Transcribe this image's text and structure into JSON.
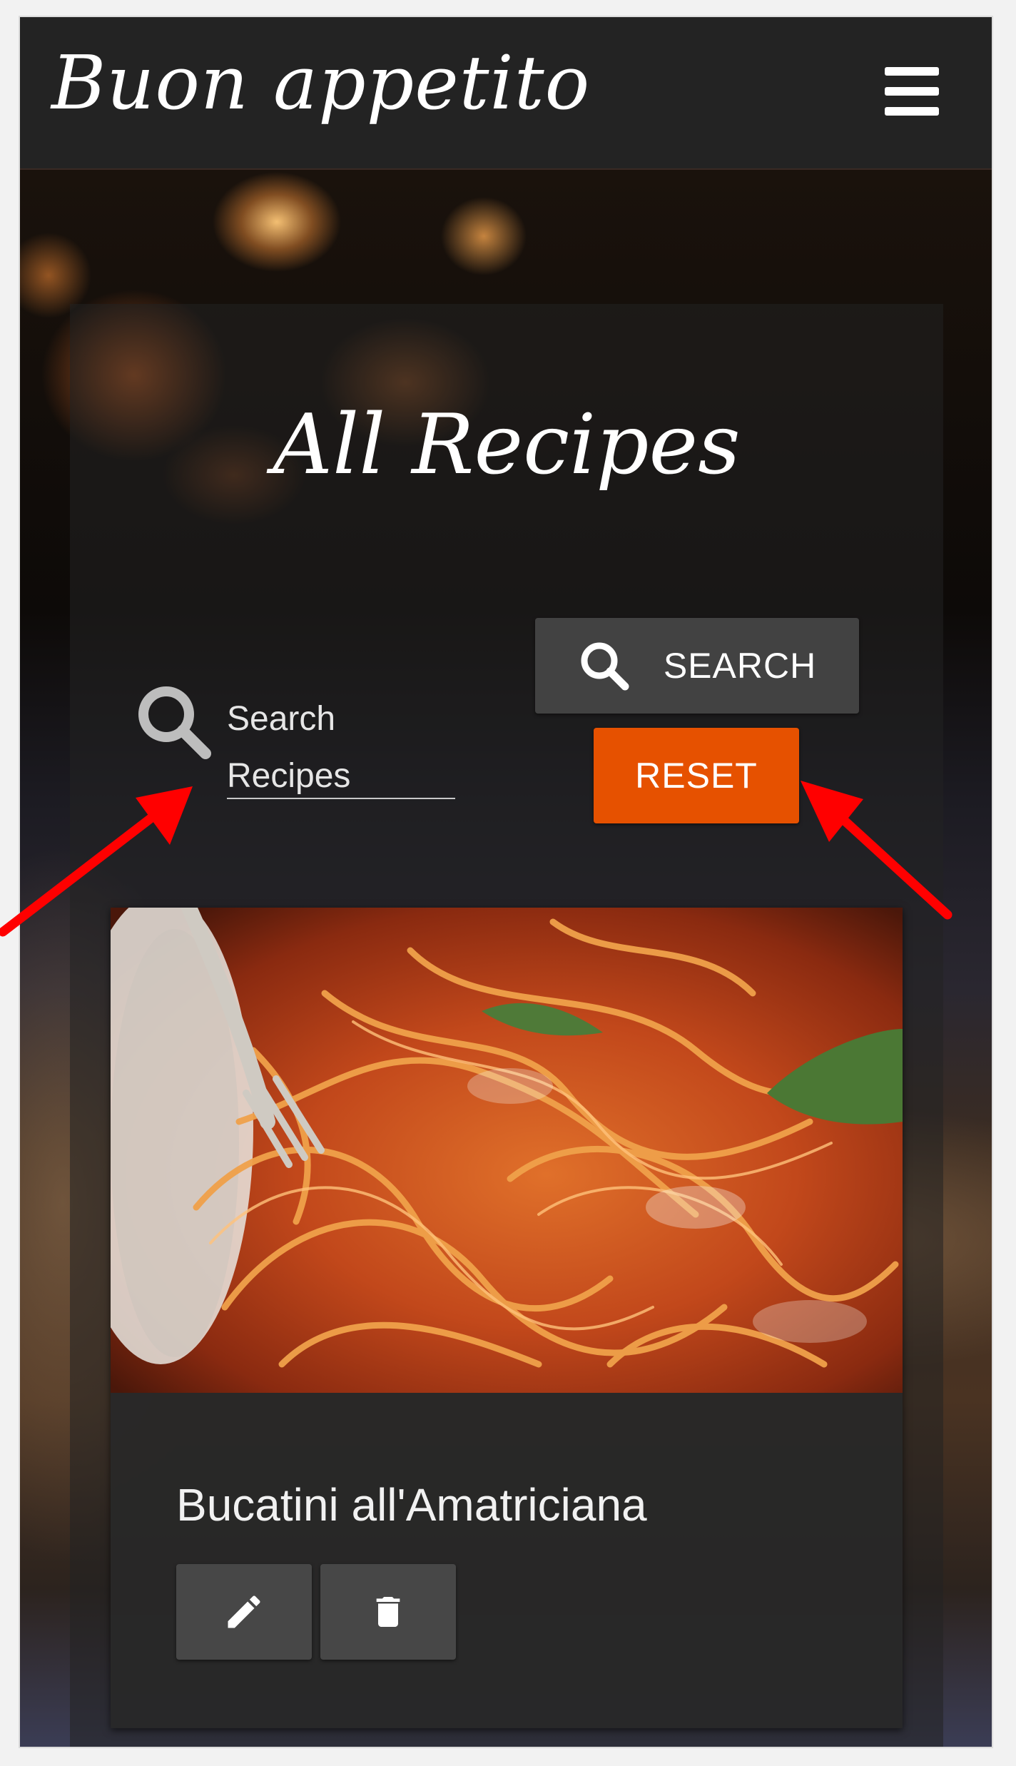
{
  "header": {
    "brand": "Buon appetito",
    "menu_icon": "hamburger-menu-icon"
  },
  "main": {
    "title": "All Recipes",
    "search": {
      "placeholder_line1": "Search",
      "placeholder_line2": "Recipes",
      "placeholder": "Search Recipes",
      "value": "",
      "icon": "search-icon"
    },
    "search_button": {
      "label": "SEARCH",
      "icon": "search-icon",
      "color": "#424242"
    },
    "reset_button": {
      "label": "RESET",
      "color": "#e65100"
    }
  },
  "recipes": [
    {
      "title": "Bucatini all'Amatriciana",
      "image": "spaghetti-with-tomato-sauce-and-fork",
      "actions": [
        {
          "icon": "edit-pencil-icon"
        },
        {
          "icon": "delete-trash-icon"
        }
      ]
    }
  ],
  "annotations": {
    "arrow_color": "#ff0000"
  }
}
